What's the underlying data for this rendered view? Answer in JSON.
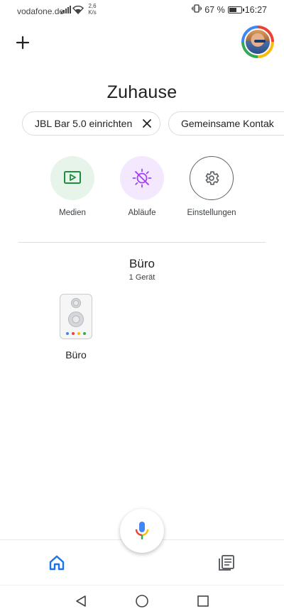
{
  "status_bar": {
    "carrier": "vodafone.de",
    "speed_value": "2,6",
    "speed_unit": "K/s",
    "battery_percent": "67 %",
    "battery_level": 0.67,
    "time": "16:27"
  },
  "header": {
    "add_icon": "plus-icon",
    "avatar_icon": "profile-avatar"
  },
  "title": "Zuhause",
  "chips": [
    {
      "label": "JBL Bar 5.0 einrichten",
      "close_icon": "close-icon"
    },
    {
      "label": "Gemeinsame Kontak"
    }
  ],
  "actions": [
    {
      "label": "Medien",
      "icon": "play-screen-icon",
      "color": "#1e8e3e",
      "bg": "#e6f4ea"
    },
    {
      "label": "Abläufe",
      "icon": "sun-routine-icon",
      "color": "#a142f4",
      "bg": "#f3e8fd"
    },
    {
      "label": "Einstellungen",
      "icon": "gear-icon",
      "color": "#5f6368",
      "bg": "#ffffff"
    }
  ],
  "room": {
    "name": "Büro",
    "device_count": "1 Gerät"
  },
  "devices": [
    {
      "label": "Büro",
      "icon": "speaker-icon",
      "dot_colors": [
        "#4285f4",
        "#ea4335",
        "#fbbc05",
        "#34a853"
      ]
    }
  ],
  "fab": {
    "icon": "microphone-icon"
  },
  "bottom_nav": [
    {
      "icon": "home-icon",
      "active": true,
      "color": "#1a73e8"
    },
    {
      "icon": "feed-icon",
      "active": false,
      "color": "#5f6368"
    }
  ],
  "system_nav": [
    "back-icon",
    "home-circle-icon",
    "recents-icon"
  ]
}
